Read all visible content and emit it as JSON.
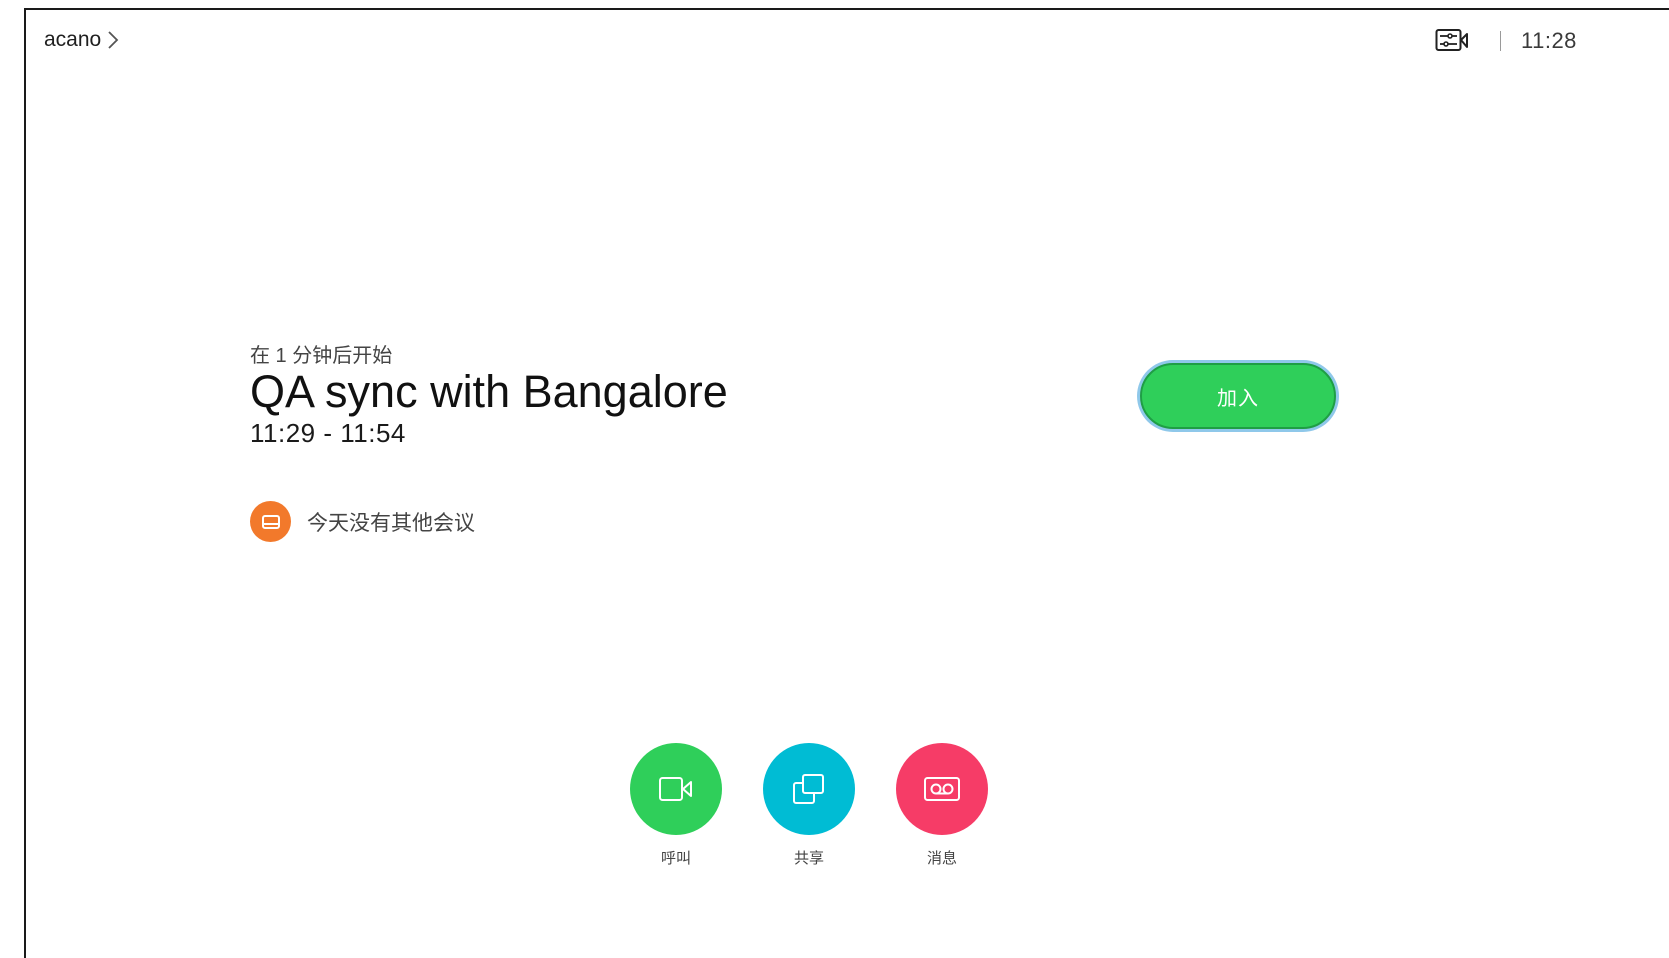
{
  "header": {
    "device_name": "acano",
    "clock": "11:28",
    "camera_status_icon": "camera-settings-icon"
  },
  "meeting": {
    "starts_in": "在 1 分钟后开始",
    "title": "QA sync with Bangalore",
    "time_range": "11:29 - 11:54",
    "join_label": "加入"
  },
  "calendar_note": {
    "text": "今天没有其他会议",
    "icon": "calendar-icon",
    "color": "#f2792b"
  },
  "actions": [
    {
      "label": "呼叫",
      "icon": "video-camera-icon",
      "color": "#2fcf5a"
    },
    {
      "label": "共享",
      "icon": "share-screen-icon",
      "color": "#00bcd4"
    },
    {
      "label": "消息",
      "icon": "voicemail-icon",
      "color": "#f63c67"
    }
  ],
  "colors": {
    "join_button": "#2fcf5a",
    "join_focus_ring": "#8fc8ea"
  }
}
